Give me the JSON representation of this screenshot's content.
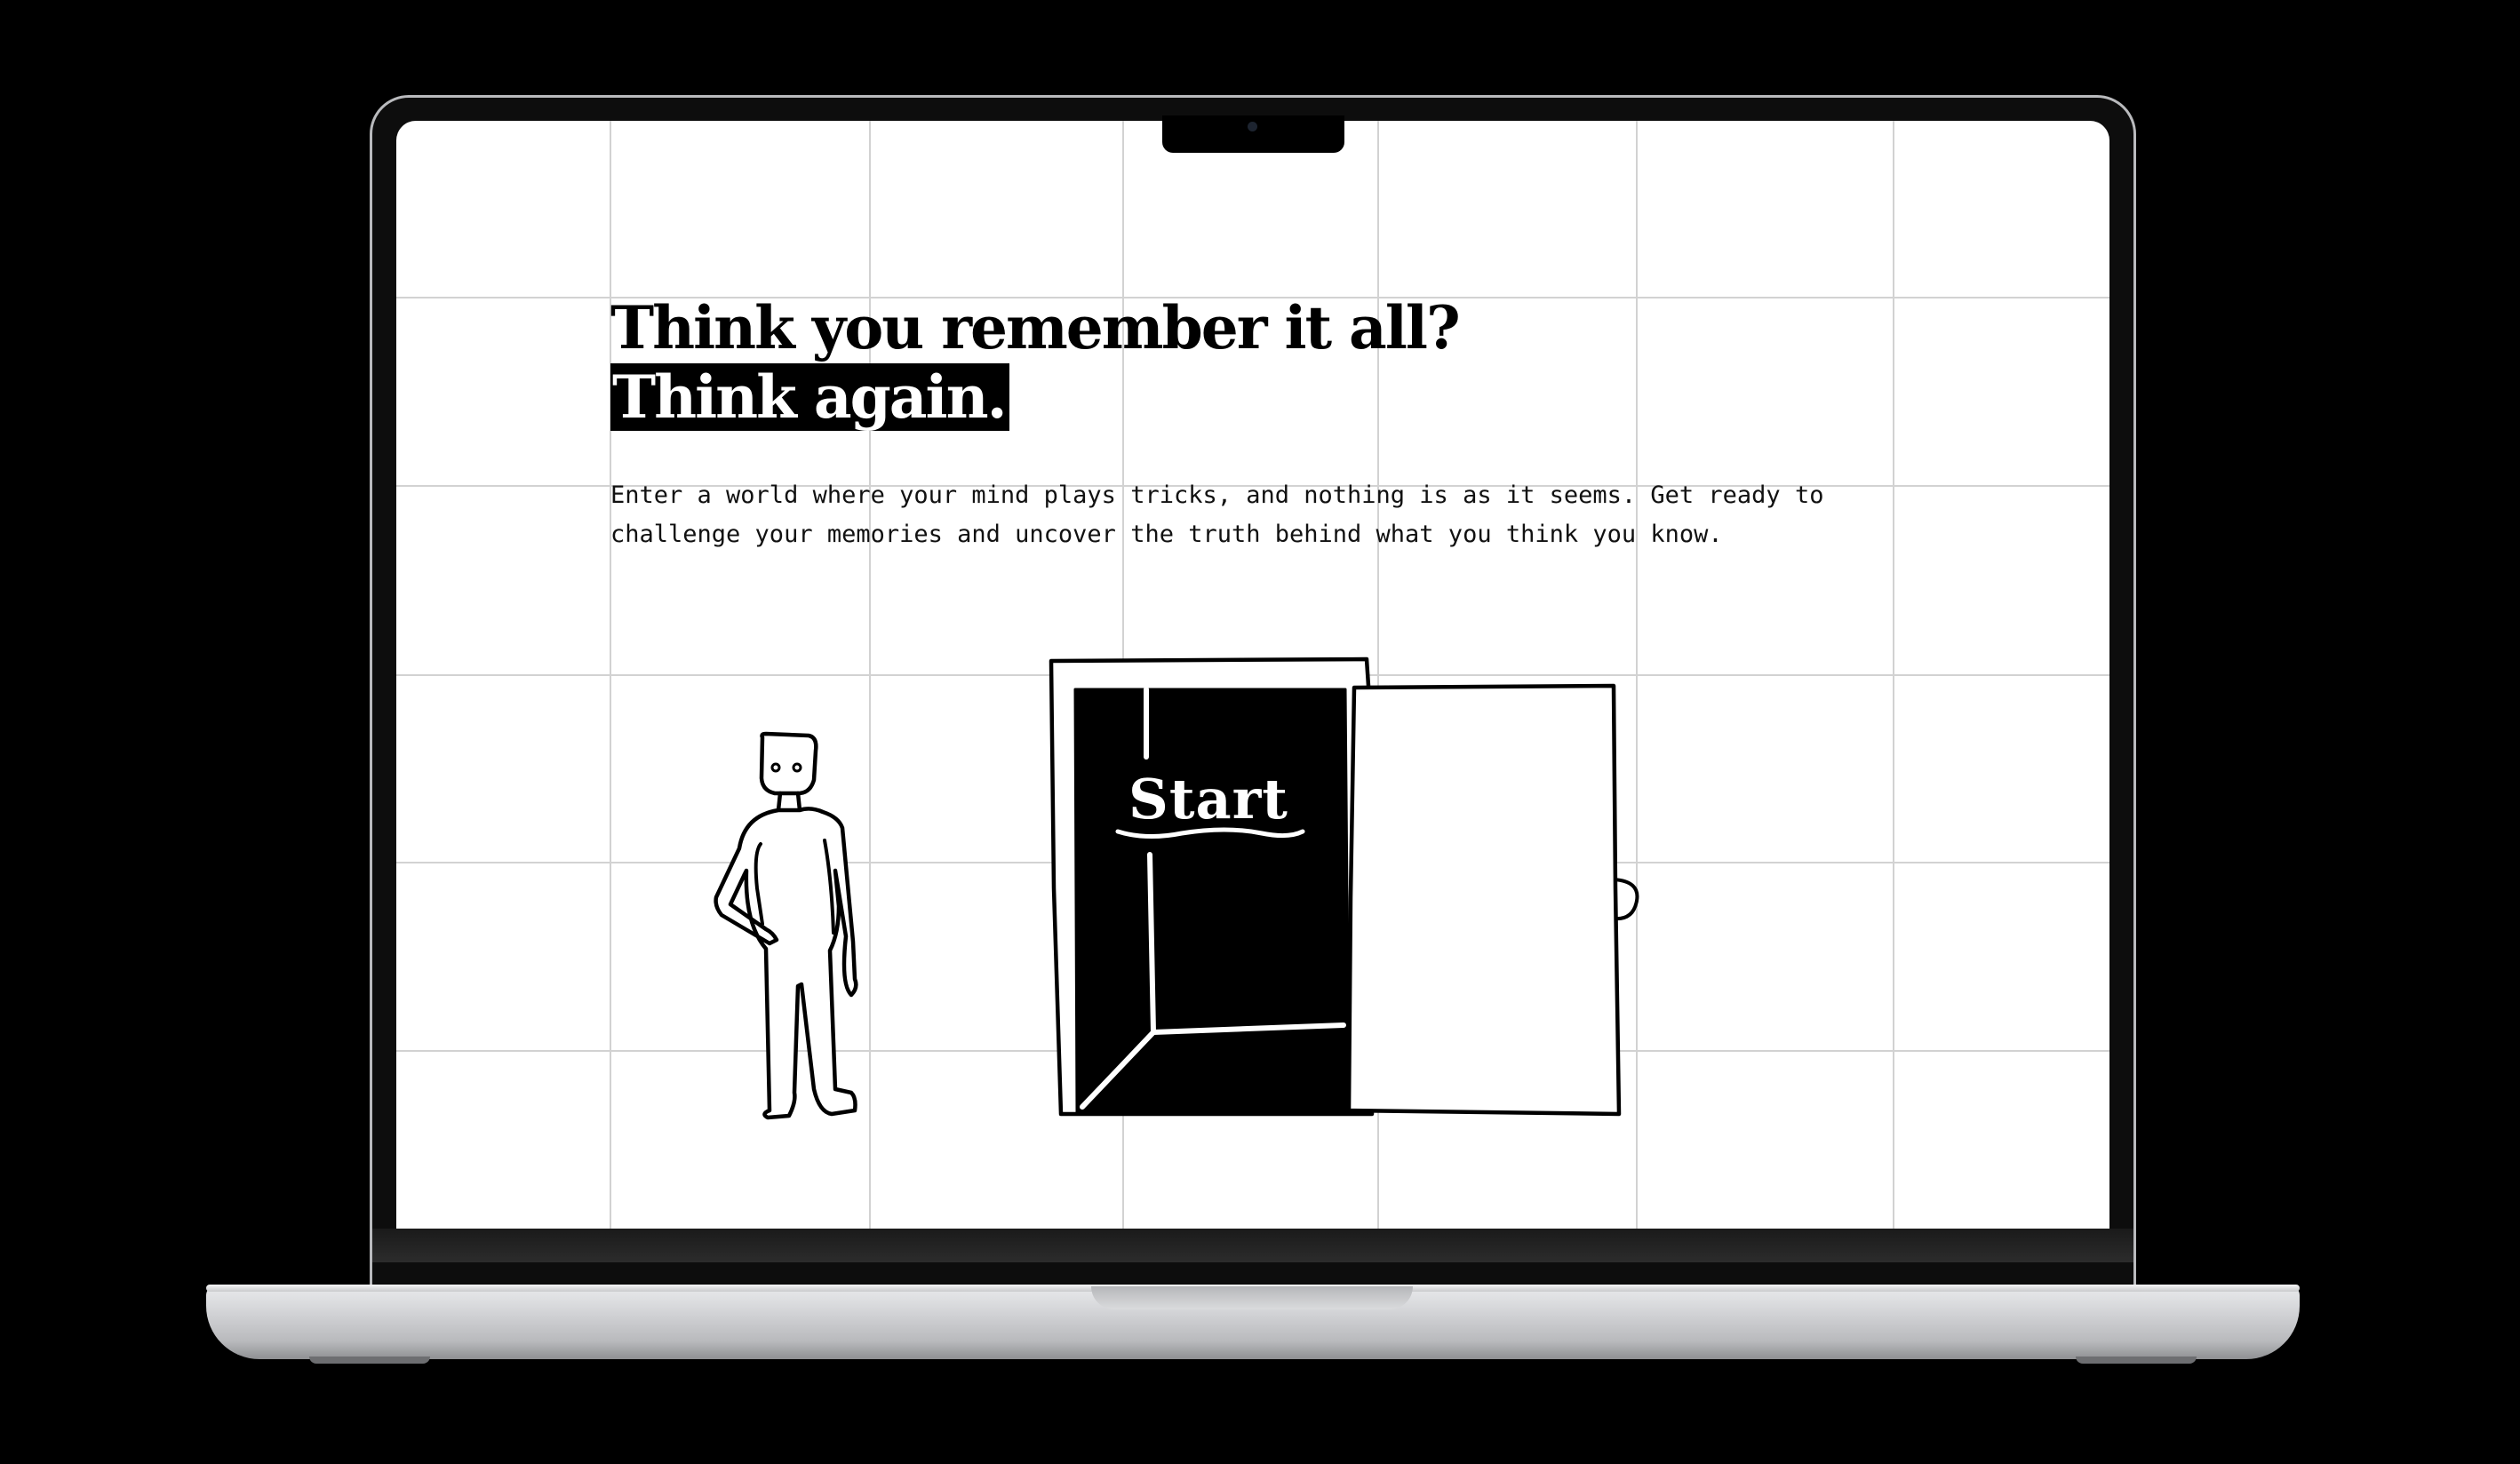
{
  "hero": {
    "headline_line1": "Think you remember it all?",
    "headline_line2": "Think again.",
    "intro_text": "Enter a world where your mind plays tricks, and nothing is as it seems. Get ready to challenge your memories and uncover the truth behind what you think you know."
  },
  "door": {
    "start_label": "Start"
  },
  "colors": {
    "background": "#ffffff",
    "ink": "#000000",
    "grid": "#d2d2d2",
    "device_frame": "#000000"
  },
  "icons": {
    "figure": "stick-figure-illustration",
    "door": "open-door-illustration"
  }
}
